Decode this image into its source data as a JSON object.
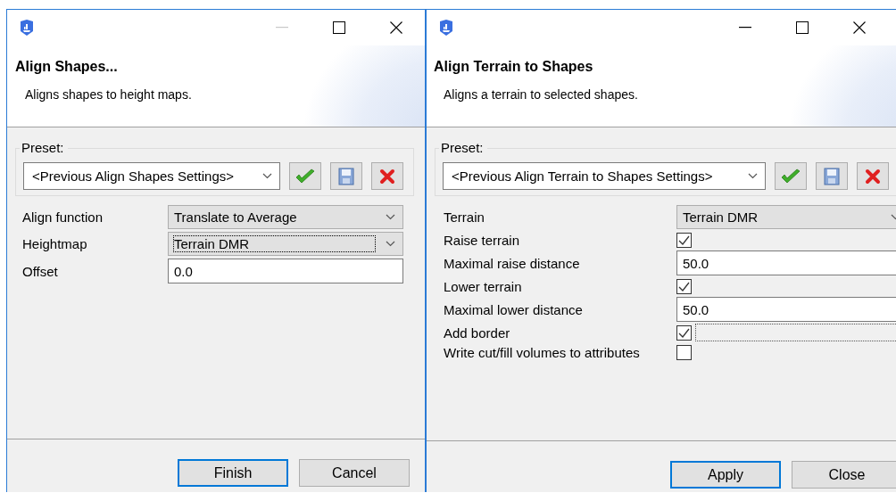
{
  "windows": [
    {
      "title_bar": {
        "minimize_disabled": true
      },
      "title": "Align Shapes...",
      "description": "Aligns shapes to height maps.",
      "preset": {
        "label": "Preset:",
        "value": "<Previous Align Shapes Settings>"
      },
      "rows": [
        {
          "kind": "combo",
          "label": "Align function",
          "value": "Translate to Average",
          "focused": false
        },
        {
          "kind": "combo",
          "label": "Heightmap",
          "value": "Terrain DMR",
          "focused": true
        },
        {
          "kind": "text",
          "label": "Offset",
          "value": "0.0"
        }
      ],
      "buttons": [
        {
          "label": "Finish",
          "default": true
        },
        {
          "label": "Cancel",
          "default": false
        }
      ]
    },
    {
      "title_bar": {
        "minimize_disabled": false
      },
      "title": "Align Terrain to Shapes",
      "description": "Aligns a terrain to selected shapes.",
      "preset": {
        "label": "Preset:",
        "value": "<Previous Align Terrain to Shapes Settings>"
      },
      "rows": [
        {
          "kind": "combo",
          "label": "Terrain",
          "value": "Terrain DMR",
          "focused": false
        },
        {
          "kind": "checkbox",
          "label": "Raise terrain",
          "checked": true,
          "focused": false
        },
        {
          "kind": "text",
          "label": "Maximal raise distance",
          "value": "50.0"
        },
        {
          "kind": "checkbox",
          "label": "Lower terrain",
          "checked": true,
          "focused": false
        },
        {
          "kind": "text",
          "label": "Maximal lower distance",
          "value": "50.0"
        },
        {
          "kind": "checkbox",
          "label": "Add border",
          "checked": true,
          "focused": true
        },
        {
          "kind": "checkbox",
          "label": "Write cut/fill volumes to attributes",
          "checked": false,
          "focused": false
        }
      ],
      "buttons": [
        {
          "label": "Apply",
          "default": true
        },
        {
          "label": "Close",
          "default": false
        }
      ]
    }
  ]
}
